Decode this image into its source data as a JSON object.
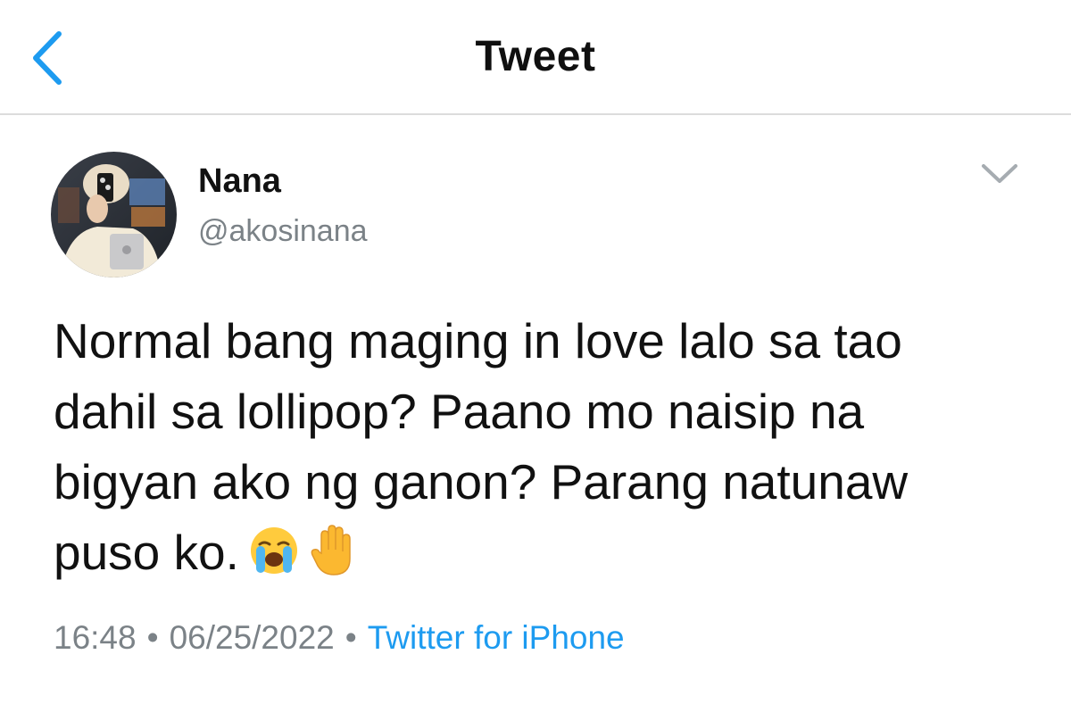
{
  "header": {
    "title": "Tweet",
    "back_icon": "chevron-left-icon"
  },
  "author": {
    "display_name": "Nana",
    "handle": "@akosinana",
    "more_icon": "chevron-down-icon"
  },
  "tweet": {
    "text": "Normal bang maging in love lalo sa tao\ndahil sa lollipop? Paano mo naisip na\nbigyan ako ng ganon? Parang natunaw\npuso ko.",
    "emojis": [
      "loudly-crying-face-icon",
      "raised-hand-icon"
    ]
  },
  "meta": {
    "time": "16:48",
    "separator": "•",
    "date": "06/25/2022",
    "source": "Twitter for iPhone"
  },
  "colors": {
    "accent": "#1d9bf0",
    "secondary_text": "#7b8287",
    "divider": "#dcdcdc"
  }
}
